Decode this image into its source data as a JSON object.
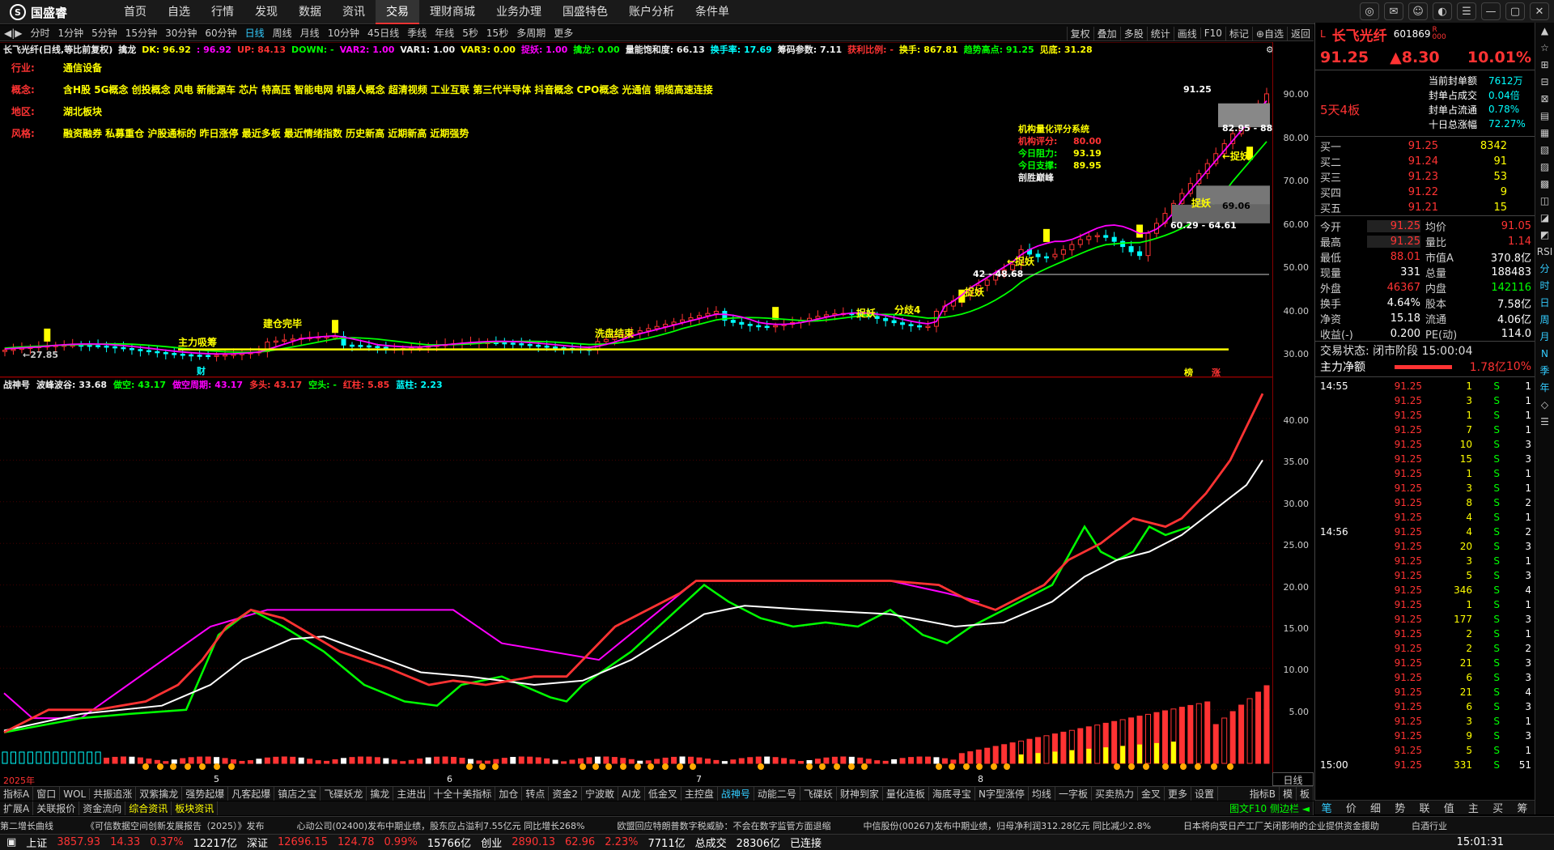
{
  "app": {
    "logo": "国盛睿",
    "logo_glyph": "S"
  },
  "nav": [
    "首页",
    "自选",
    "行情",
    "发现",
    "数据",
    "资讯",
    "交易",
    "理财商城",
    "业务办理",
    "国盛特色",
    "账户分析",
    "条件单"
  ],
  "nav_active": "交易",
  "period_tools": [
    "分时",
    "1分钟",
    "5分钟",
    "15分钟",
    "30分钟",
    "60分钟",
    "日线",
    "周线",
    "月线",
    "10分钟",
    "45日线",
    "季线",
    "年线",
    "5秒",
    "15秒",
    "多周期",
    "更多"
  ],
  "period_active": "日线",
  "right_tools": [
    "复权",
    "叠加",
    "多股",
    "统计",
    "画线",
    "F10",
    "标记",
    "⊕自选",
    "返回"
  ],
  "legend": [
    {
      "t": "长飞光纤(日线,等比前复权)",
      "c": "w"
    },
    {
      "t": "擒龙",
      "c": "w"
    },
    {
      "t": "DK: 96.92",
      "c": "y"
    },
    {
      "t": ": 96.92",
      "c": "m"
    },
    {
      "t": "UP: 84.13",
      "c": "r"
    },
    {
      "t": "DOWN: -",
      "c": "g"
    },
    {
      "t": "VAR2: 1.00",
      "c": "m"
    },
    {
      "t": "VAR1: 1.00",
      "c": "w"
    },
    {
      "t": "VAR3: 0.00",
      "c": "y"
    },
    {
      "t": "捉妖: 1.00",
      "c": "m"
    },
    {
      "t": "擒龙: 0.00",
      "c": "g"
    },
    {
      "t": "量能饱和度: 66.13",
      "c": "w"
    },
    {
      "t": "换手率: 17.69",
      "c": "c"
    },
    {
      "t": "筹码参数: 7.11",
      "c": "w"
    },
    {
      "t": "获利比例: -",
      "c": "r"
    },
    {
      "t": "换手: 867.81",
      "c": "y"
    },
    {
      "t": "趋势高点: 91.25",
      "c": "g"
    },
    {
      "t": "见底: 31.28",
      "c": "y"
    }
  ],
  "tags": [
    {
      "label": "行业:",
      "value": "通信设备"
    },
    {
      "label": "概念:",
      "value": "含H股 5G概念 创投概念 风电 新能源车 芯片 特高压 智能电网 机器人概念 超清视频 工业互联 第三代半导体 抖音概念 CPO概念 光通信 铜缆高速连接"
    },
    {
      "label": "地区:",
      "value": "湖北板块"
    },
    {
      "label": "风格:",
      "value": "融资融券 私募重仓 沪股通标的 昨日涨停 最近多板 最近情绪指数 历史新高 近期新高 近期强势"
    }
  ],
  "score": {
    "title": "机构量化评分系统",
    "rows": [
      {
        "label": "机构评分:",
        "value": "80.00"
      },
      {
        "label": "今日阻力:",
        "value": "93.19"
      },
      {
        "label": "今日支撑:",
        "value": "89.95"
      }
    ],
    "footer": "剖胜巅峰"
  },
  "annotations": {
    "a1": "主力吸筹",
    "a2": "建仓完毕",
    "a3": "洗盘结束",
    "a4": "捉妖",
    "a5": "分歧4",
    "a6": "捉妖",
    "a7": "←捉妖",
    "a8": "←捉妖",
    "a9": "捉妖",
    "a10": "←27.85",
    "a11": "42 - 48.68",
    "a12": "60.29 - 64.61",
    "a13": "69.06",
    "a14": "82.95 - 88.0",
    "a15": "91.25",
    "fin": "财",
    "t1": "榜",
    "t2": "涨"
  },
  "price_axis": [
    "90.00",
    "80.00",
    "70.00",
    "60.00",
    "50.00",
    "40.00",
    "30.00"
  ],
  "osc_legend": [
    {
      "t": "战神号",
      "c": "w"
    },
    {
      "t": "波峰波谷: 33.68",
      "c": "w"
    },
    {
      "t": "做空: 43.17",
      "c": "g"
    },
    {
      "t": "做空周期: 43.17",
      "c": "m"
    },
    {
      "t": "多头: 43.17",
      "c": "r"
    },
    {
      "t": "空头: -",
      "c": "g"
    },
    {
      "t": "红柱: 5.85",
      "c": "r"
    },
    {
      "t": "蓝柱: 2.23",
      "c": "c"
    }
  ],
  "osc_axis": [
    "40.00",
    "35.00",
    "30.00",
    "25.00",
    "20.00",
    "15.00",
    "10.00",
    "5.00"
  ],
  "dates": [
    "2025年",
    "5",
    "6",
    "7",
    "8"
  ],
  "period_label": "日线",
  "tabs1": [
    "指标A",
    "窗口",
    "WOL",
    "共振追涨",
    "双紫擒龙",
    "强势起爆",
    "凡客起爆",
    "镇店之宝",
    "飞碟妖龙",
    "擒龙",
    "主进出",
    "十全十美指标",
    "加仓",
    "转点",
    "资金2",
    "宁波敢",
    "AI龙",
    "低金叉",
    "主控盘",
    "战神号",
    "动能二号",
    "飞碟妖",
    "财神到家",
    "量化连板",
    "海底寻宝",
    "N字型涨停",
    "均线",
    "一字板",
    "买卖热力",
    "金叉",
    "更多",
    "设置"
  ],
  "tabs1_active": "战神号",
  "tabs1_right": [
    "指标B",
    "模",
    "板"
  ],
  "tabs2": [
    "扩展A",
    "关联报价",
    "资金流向",
    "综合资讯",
    "板块资讯"
  ],
  "tabs2_right": "图文F10 侧边栏 ◄",
  "news": [
    "第二增长曲线",
    "《可信数据空间创新发展报告（2025）》发布",
    "心动公司(02400)发布中期业绩，股东应占溢利7.55亿元 同比增长268%",
    "欧盟回应特朗普数字税威胁：不会在数字监管方面退缩",
    "中信股份(00267)发布中期业绩，归母净利润312.28亿元 同比减少2.8%",
    "日本将向受日产工厂关闭影响的企业提供资金援助",
    "白酒行业"
  ],
  "status": [
    {
      "t": "上证",
      "c": "w"
    },
    {
      "t": "3857.93",
      "c": "r"
    },
    {
      "t": "14.33",
      "c": "r"
    },
    {
      "t": "0.37%",
      "c": "r"
    },
    {
      "t": "12217亿",
      "c": "w"
    },
    {
      "t": "深证",
      "c": "w"
    },
    {
      "t": "12696.15",
      "c": "r"
    },
    {
      "t": "124.78",
      "c": "r"
    },
    {
      "t": "0.99%",
      "c": "r"
    },
    {
      "t": "15766亿",
      "c": "w"
    },
    {
      "t": "创业",
      "c": "w"
    },
    {
      "t": "2890.13",
      "c": "r"
    },
    {
      "t": "62.96",
      "c": "r"
    },
    {
      "t": "2.23%",
      "c": "r"
    },
    {
      "t": "7711亿",
      "c": "w"
    },
    {
      "t": "总成交",
      "c": "w"
    },
    {
      "t": "28306亿",
      "c": "w"
    },
    {
      "t": "已连接",
      "c": "w"
    }
  ],
  "clock": "15:01:31",
  "quote": {
    "mark": "L",
    "name": "长飞光纤",
    "code": "601869",
    "flag": "R",
    "flag2": "000",
    "price": "91.25",
    "change": "▲8.30",
    "pct": "10.01%",
    "boards": "5天4板",
    "seal": [
      {
        "l": "当前封单额",
        "v": "7612万"
      },
      {
        "l": "封单占成交",
        "v": "0.04倍"
      },
      {
        "l": "封单占流通",
        "v": "0.78%"
      },
      {
        "l": "十日总涨幅",
        "v": "72.27%"
      }
    ],
    "book": [
      {
        "l": "买一",
        "p": "91.25",
        "v": "8342"
      },
      {
        "l": "买二",
        "p": "91.24",
        "v": "91"
      },
      {
        "l": "买三",
        "p": "91.23",
        "v": "53"
      },
      {
        "l": "买四",
        "p": "91.22",
        "v": "9"
      },
      {
        "l": "买五",
        "p": "91.21",
        "v": "15"
      }
    ],
    "stats": [
      {
        "l1": "今开",
        "v1": "91.25",
        "c1": "rd",
        "l2": "均价",
        "v2": "91.05",
        "c2": "rd"
      },
      {
        "l1": "最高",
        "v1": "91.25",
        "c1": "rd",
        "l2": "量比",
        "v2": "1.14",
        "c2": "rd"
      },
      {
        "l1": "最低",
        "v1": "88.01",
        "c1": "rd",
        "l2": "市值A",
        "v2": "370.8亿",
        "c2": "wt"
      },
      {
        "l1": "现量",
        "v1": "331",
        "c1": "wt",
        "l2": "总量",
        "v2": "188483",
        "c2": "wt"
      },
      {
        "l1": "外盘",
        "v1": "46367",
        "c1": "rd",
        "l2": "内盘",
        "v2": "142116",
        "c2": "gr"
      },
      {
        "l1": "换手",
        "v1": "4.64%",
        "c1": "wt",
        "l2": "股本",
        "v2": "7.58亿",
        "c2": "wt"
      },
      {
        "l1": "净资",
        "v1": "15.18",
        "c1": "wt",
        "l2": "流通",
        "v2": "4.06亿",
        "c2": "wt"
      },
      {
        "l1": "收益(-)",
        "v1": "0.200",
        "c1": "wt",
        "l2": "PE(动)",
        "v2": "114.0",
        "c2": "wt"
      }
    ],
    "trade_state": "交易状态: 闭市阶段 15:00:04",
    "net_label": "主力净额",
    "net_value": "1.78亿",
    "net_pct": "10%",
    "tick_times": [
      "14:55",
      "14:56",
      "15:00"
    ],
    "ticks": [
      [
        "91.25",
        "1",
        "S",
        "1"
      ],
      [
        "91.25",
        "3",
        "S",
        "1"
      ],
      [
        "91.25",
        "1",
        "S",
        "1"
      ],
      [
        "91.25",
        "7",
        "S",
        "1"
      ],
      [
        "91.25",
        "10",
        "S",
        "3"
      ],
      [
        "91.25",
        "15",
        "S",
        "3"
      ],
      [
        "91.25",
        "1",
        "S",
        "1"
      ],
      [
        "91.25",
        "3",
        "S",
        "1"
      ],
      [
        "91.25",
        "8",
        "S",
        "2"
      ],
      [
        "91.25",
        "4",
        "S",
        "1"
      ],
      [
        "91.25",
        "4",
        "S",
        "2"
      ],
      [
        "91.25",
        "20",
        "S",
        "3"
      ],
      [
        "91.25",
        "3",
        "S",
        "1"
      ],
      [
        "91.25",
        "5",
        "S",
        "3"
      ],
      [
        "91.25",
        "346",
        "S",
        "4"
      ],
      [
        "91.25",
        "1",
        "S",
        "1"
      ],
      [
        "91.25",
        "177",
        "S",
        "3"
      ],
      [
        "91.25",
        "2",
        "S",
        "1"
      ],
      [
        "91.25",
        "2",
        "S",
        "2"
      ],
      [
        "91.25",
        "21",
        "S",
        "3"
      ],
      [
        "91.25",
        "6",
        "S",
        "3"
      ],
      [
        "91.25",
        "21",
        "S",
        "4"
      ],
      [
        "91.25",
        "6",
        "S",
        "3"
      ],
      [
        "91.25",
        "3",
        "S",
        "1"
      ],
      [
        "91.25",
        "9",
        "S",
        "3"
      ],
      [
        "91.25",
        "5",
        "S",
        "1"
      ],
      [
        "91.25",
        "331",
        "S",
        "51"
      ]
    ],
    "tabs": [
      "笔",
      "价",
      "细",
      "势",
      "联",
      "值",
      "主",
      "买",
      "筹"
    ],
    "tabs_active": "笔"
  },
  "vstrip": [
    "▲",
    "☆",
    "⊞",
    "⊟",
    "⊠",
    "▤",
    "▦",
    "▧",
    "▨",
    "▩",
    "◫",
    "◪",
    "◩",
    "RSI",
    "分",
    "时",
    "日",
    "周",
    "月",
    "N",
    "季",
    "年",
    "◇",
    "☰"
  ]
}
